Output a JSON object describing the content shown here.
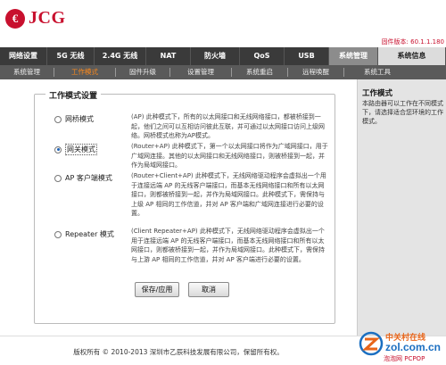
{
  "header": {
    "brand_mark": "€",
    "brand_name": "JCG",
    "firmware": "固件版本: 60.1.1.180"
  },
  "mainnav": [
    {
      "label": "网络设置"
    },
    {
      "label": "5G 无线"
    },
    {
      "label": "2.4G 无线"
    },
    {
      "label": "NAT"
    },
    {
      "label": "防火墙"
    },
    {
      "label": "QoS"
    },
    {
      "label": "USB"
    },
    {
      "label": "系统管理",
      "active": true
    },
    {
      "label": "系统信息"
    }
  ],
  "subnav": [
    {
      "label": "系统管理"
    },
    {
      "label": "工作模式",
      "active": true
    },
    {
      "label": "固件升级"
    },
    {
      "label": "设置管理"
    },
    {
      "label": "系统重启"
    },
    {
      "label": "远程唤醒"
    },
    {
      "label": "系统工具"
    }
  ],
  "panel": {
    "title": "工作模式设置",
    "modes": [
      {
        "label": "网桥模式",
        "selected": false,
        "desc": "(AP) 此种模式下，所有的以太网接口和无线网络接口，都被桥接到一起，他们之间可以互相访问彼此互联，并可通过以太网接口访问上级网络。网桥模式也称为AP模式。"
      },
      {
        "label": "网关模式",
        "selected": true,
        "desc": "(Router+AP) 此种模式下，第一个以太网接口将作为广域网接口，用于广域网连接。其他的以太网接口和无线网络接口，则被桥接到一起，并作为局域网接口。"
      },
      {
        "label": "AP 客户端模式",
        "selected": false,
        "desc": "(Router+Client+AP) 此种模式下，无线网络驱动程序会虚拟出一个用于连接远端 AP 的无线客户端接口，而基本无线网络接口和所有以太网接口，则都被桥接到一起，并作为局域网接口。此种模式下，需保持与上级 AP 相同的工作信道，并对 AP 客户端和广域网连接进行必要的设置。"
      },
      {
        "label": "Repeater 模式",
        "selected": false,
        "desc": "(Client Repeater+AP) 此种模式下，无线网络驱动程序会虚拟出一个用于连接远端 AP 的无线客户端接口，而基本无线网络接口和所有以太网接口，则都被桥接到一起，并作为局域网接口。此种模式下，需保持与上游 AP 相同的工作信道，并对 AP 客户端进行必要的设置。"
      }
    ],
    "save_label": "保存/应用",
    "cancel_label": "取消"
  },
  "help": {
    "title": "工作模式",
    "text": "本路由器可以工作在不同模式下，请选择适合您环境的工作模式。"
  },
  "footer": {
    "copyright": "版权所有 © 2010-2013 深圳市乙辰科技发展有限公司，保留所有权。",
    "watermark_cn": "中关村在线",
    "watermark_en": "zol.com.cn",
    "watermark_sub": "泡泡网 PCPOP"
  },
  "colors": {
    "brand": "#c8102e",
    "nav_bg": "#3a3a3a",
    "subnav_bg": "#5a5a5a",
    "subnav_active": "#ff8a1a"
  }
}
